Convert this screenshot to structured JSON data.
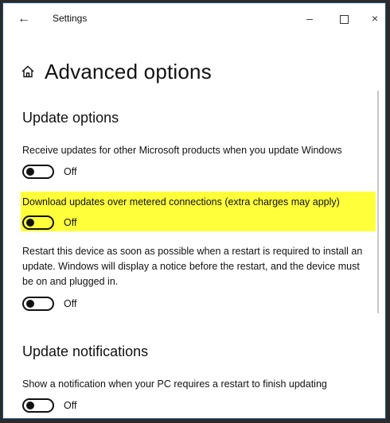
{
  "window": {
    "title": "Settings",
    "back_icon": "←",
    "minimize_icon": "–",
    "close_icon": "×"
  },
  "page": {
    "title": "Advanced options",
    "home_icon": "home-icon"
  },
  "update_options": {
    "section_title": "Update options",
    "settings": [
      {
        "label": "Receive updates for other Microsoft products when you update Windows",
        "state": "Off",
        "highlighted": false
      },
      {
        "label": "Download updates over metered connections (extra charges may apply)",
        "state": "Off",
        "highlighted": true
      },
      {
        "label": "Restart this device as soon as possible when a restart is required to install an update. Windows will display a notice before the restart, and the device must be on and plugged in.",
        "state": "Off",
        "highlighted": false
      }
    ]
  },
  "update_notifications": {
    "section_title": "Update notifications",
    "settings": [
      {
        "label": "Show a notification when your PC requires a restart to finish updating",
        "state": "Off",
        "highlighted": false
      }
    ]
  },
  "colors": {
    "highlight": "#ffff3a",
    "window_border": "#1f4e79"
  }
}
